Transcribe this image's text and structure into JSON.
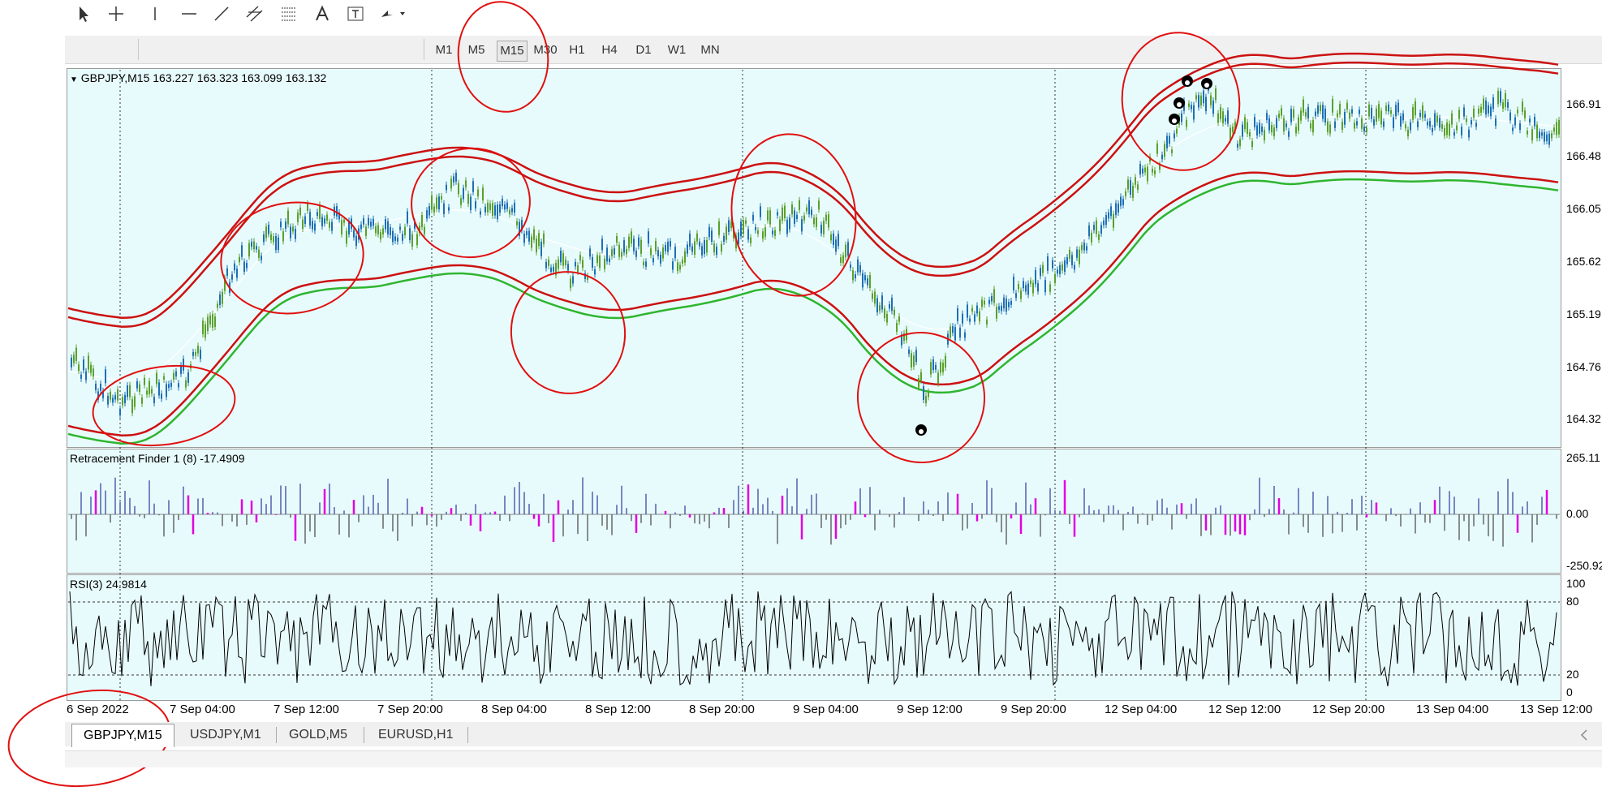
{
  "toolbar": {
    "tools": [
      "cursor-icon",
      "crosshair-icon",
      "vertical-line-icon",
      "horizontal-line-icon",
      "trendline-icon",
      "equidistant-channel-icon",
      "fibonacci-icon",
      "text-icon",
      "text-label-icon",
      "arrows-icon"
    ],
    "timeframes": [
      "M1",
      "M5",
      "M15",
      "M30",
      "H1",
      "H4",
      "D1",
      "W1",
      "MN"
    ],
    "active_timeframe": "M15"
  },
  "main": {
    "title": "GBPJPY,M15  163.227 163.323 163.099 163.132",
    "price_scale": [
      "166.91",
      "166.48",
      "166.05",
      "165.62",
      "165.19",
      "164.76",
      "164.32"
    ]
  },
  "retracement": {
    "title": "Retracement Finder 1 (8) -17.4909",
    "scale": [
      "265.11",
      "0.00",
      "-250.92"
    ]
  },
  "rsi": {
    "title": "RSI(3) 24.9814",
    "scale": [
      "100",
      "80",
      "20",
      "0"
    ]
  },
  "time_axis": [
    "6 Sep 2022",
    "7 Sep 04:00",
    "7 Sep 12:00",
    "7 Sep 20:00",
    "8 Sep 04:00",
    "8 Sep 12:00",
    "8 Sep 20:00",
    "9 Sep 04:00",
    "9 Sep 12:00",
    "9 Sep 20:00",
    "12 Sep 04:00",
    "12 Sep 12:00",
    "12 Sep 20:00",
    "13 Sep 04:00",
    "13 Sep 12:00"
  ],
  "tabs": [
    "GBPJPY,M15",
    "USDJPY,M1",
    "GOLD,M5",
    "EURUSD,H1"
  ],
  "active_tab": "GBPJPY,M15",
  "colors": {
    "chart_bg": "#e8fbfc",
    "bull_candle": "#5aa02c",
    "bear_candle": "#1e6fb5",
    "envelope": "#cc1111",
    "lower_band": "#2fb52f",
    "histogram_pos": "#2a3a9a",
    "histogram_neg": "#444444",
    "histogram_highlight": "#e000e0",
    "annotation": "#e01010"
  }
}
